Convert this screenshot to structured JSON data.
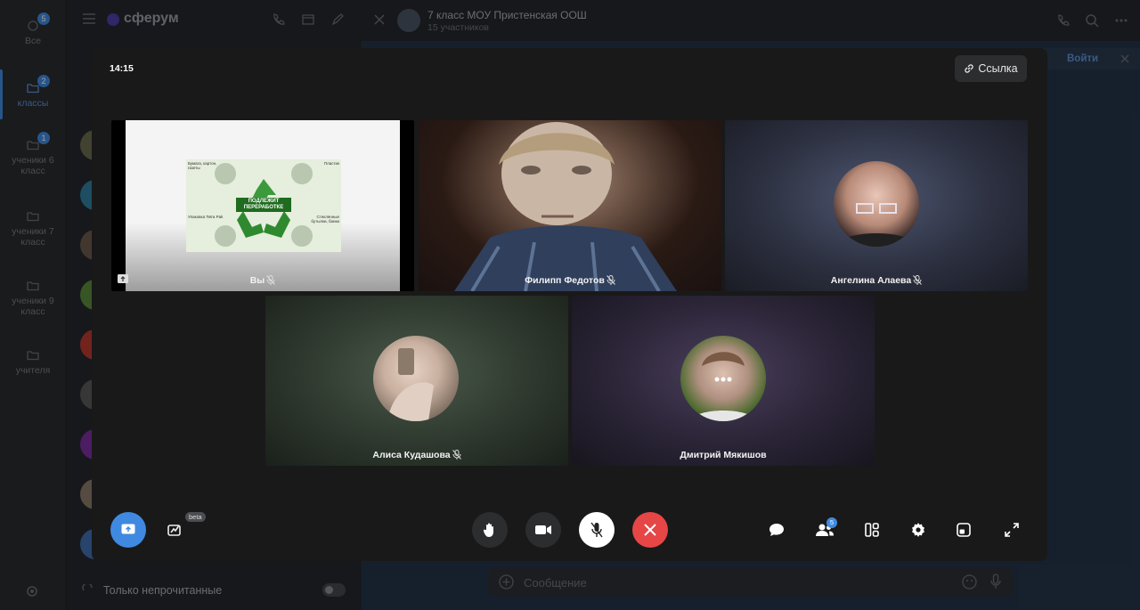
{
  "folders": [
    {
      "label": "Все",
      "badge": "5"
    },
    {
      "label": "классы",
      "badge": "2"
    },
    {
      "label": "ученики 6 класс",
      "badge": "1"
    },
    {
      "label": "ученики 7 класс",
      "badge": ""
    },
    {
      "label": "ученики 9 класс",
      "badge": ""
    },
    {
      "label": "учителя",
      "badge": ""
    }
  ],
  "brand": "сферум",
  "chat": {
    "title": "7 класс МОУ Пристенская ООШ",
    "subtitle": "15 участников",
    "join_label": "Войти",
    "message_placeholder": "Сообщение"
  },
  "unread_only_label": "Только непрочитанные",
  "call": {
    "time": "14:15",
    "link_label": "Ссылка",
    "participants_count": "5",
    "beta_label": "beta",
    "tiles": [
      {
        "name": "Вы",
        "muted": true
      },
      {
        "name": "Филипп Федотов",
        "muted": true
      },
      {
        "name": "Ангелина Алаева",
        "muted": true
      },
      {
        "name": "Алиса Кудашова",
        "muted": true
      },
      {
        "name": "Дмитрий Мякишов",
        "muted": false
      }
    ],
    "slide": {
      "center_text_1": "ПОДЛЕЖИТ",
      "center_text_2": "ПЕРЕРАБОТКЕ",
      "tl": "Бумага, картон, газеты",
      "tr": "Пластик",
      "bl": "Упаковка Tetra Pak",
      "br": "Стеклянные бутылки, банки"
    }
  },
  "colors": {
    "accent": "#3f8ae0",
    "end_call": "#e64646",
    "share_active": "#3f8ae0"
  }
}
